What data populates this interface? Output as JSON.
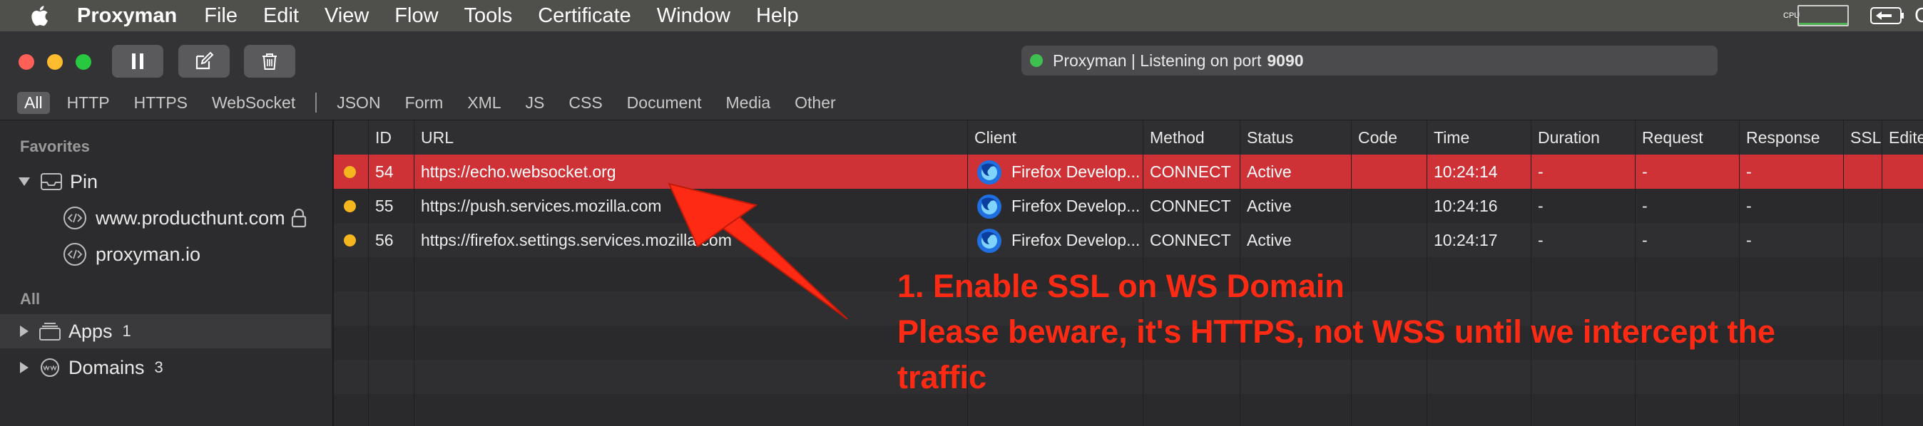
{
  "menubar": {
    "app_name": "Proxyman",
    "items": [
      "File",
      "Edit",
      "View",
      "Flow",
      "Tools",
      "Certificate",
      "Window",
      "Help"
    ],
    "cpu_label": "CPU",
    "tray_text": "Ch"
  },
  "toolbar": {
    "buttons": [
      "pause-icon",
      "edit-icon",
      "trash-icon"
    ],
    "status": {
      "text": "Proxyman | Listening on port",
      "port": "9090",
      "indicator_color": "#3fbf4f"
    }
  },
  "filters": {
    "group1": [
      "All",
      "HTTP",
      "HTTPS",
      "WebSocket"
    ],
    "group2": [
      "JSON",
      "Form",
      "XML",
      "JS",
      "CSS",
      "Document",
      "Media",
      "Other"
    ],
    "active": "All"
  },
  "sidebar": {
    "favorites_label": "Favorites",
    "pin_label": "Pin",
    "pinned": [
      "www.producthunt.com",
      "proxyman.io"
    ],
    "all_label": "All",
    "apps_label": "Apps",
    "apps_count": "1",
    "domains_label": "Domains",
    "domains_count": "3"
  },
  "table": {
    "columns": [
      "ID",
      "URL",
      "Client",
      "Method",
      "Status",
      "Code",
      "Time",
      "Duration",
      "Request",
      "Response",
      "SSL",
      "Edite"
    ],
    "rows": [
      {
        "id": "54",
        "url": "https://echo.websocket.org",
        "client": "Firefox Develop...",
        "method": "CONNECT",
        "status": "Active",
        "code": "",
        "time": "10:24:14",
        "duration": "-",
        "request": "-",
        "response": "-"
      },
      {
        "id": "55",
        "url": "https://push.services.mozilla.com",
        "client": "Firefox Develop...",
        "method": "CONNECT",
        "status": "Active",
        "code": "",
        "time": "10:24:16",
        "duration": "-",
        "request": "-",
        "response": "-"
      },
      {
        "id": "56",
        "url": "https://firefox.settings.services.mozilla.com",
        "client": "Firefox Develop...",
        "method": "CONNECT",
        "status": "Active",
        "code": "",
        "time": "10:24:17",
        "duration": "-",
        "request": "-",
        "response": "-"
      }
    ],
    "selected_color": "#cf3236",
    "pending_dot_color": "#f4b51f"
  },
  "annotation": {
    "line1": "1. Enable SSL on WS Domain",
    "line2": "Please beware, it's HTTPS, not WSS until we intercept the",
    "line3": "traffic",
    "color": "#ff2a14"
  }
}
